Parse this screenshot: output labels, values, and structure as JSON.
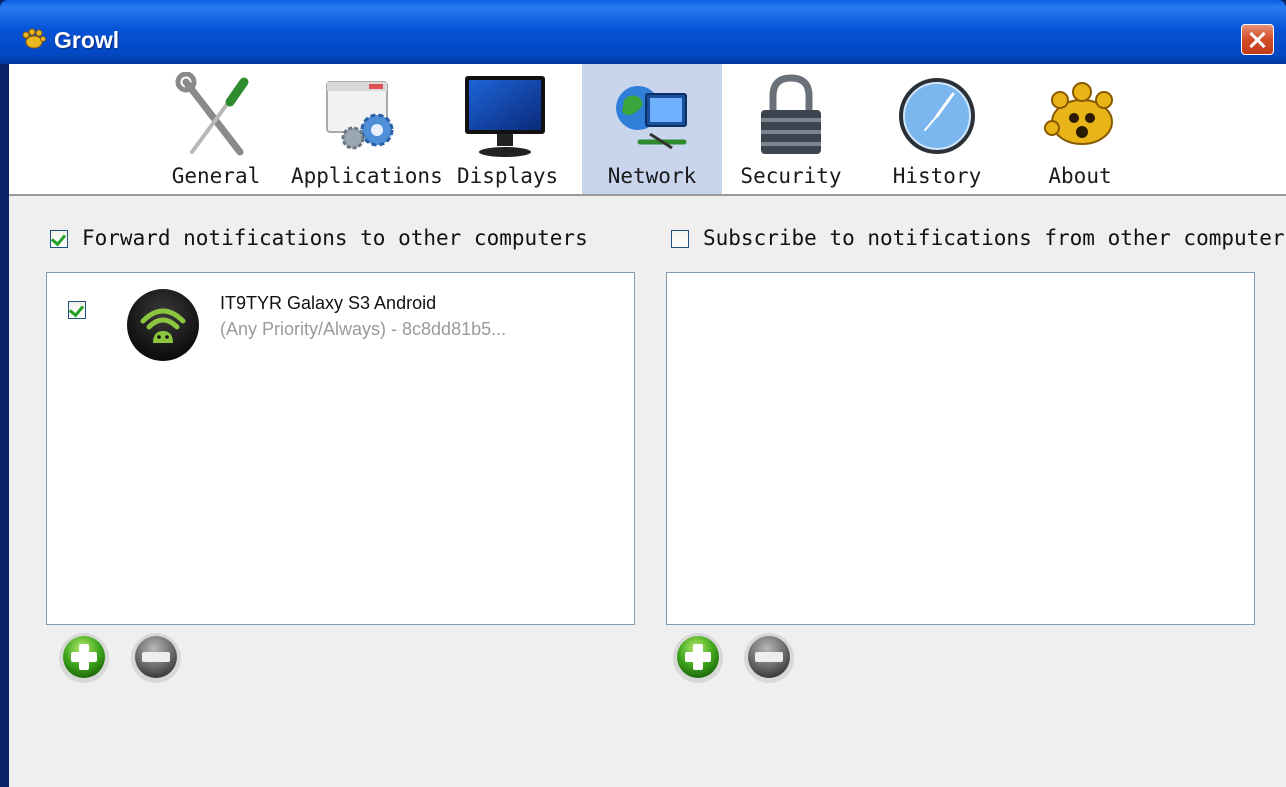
{
  "window": {
    "title": "Growl"
  },
  "toolbar": {
    "items": [
      {
        "label": "General",
        "icon": "wrench-screwdriver-icon",
        "selected": false
      },
      {
        "label": "Applications",
        "icon": "applications-gear-icon",
        "selected": false
      },
      {
        "label": "Displays",
        "icon": "monitor-icon",
        "selected": false
      },
      {
        "label": "Network",
        "icon": "network-globe-icon",
        "selected": true
      },
      {
        "label": "Security",
        "icon": "padlock-icon",
        "selected": false
      },
      {
        "label": "History",
        "icon": "clock-icon",
        "selected": false
      },
      {
        "label": "About",
        "icon": "growl-paw-icon",
        "selected": false
      }
    ]
  },
  "forward": {
    "label": "Forward notifications to other computers",
    "checked": true,
    "items": [
      {
        "checked": true,
        "name": "IT9TYR Galaxy S3 Android",
        "detail": "(Any Priority/Always) - 8c8dd81b5...",
        "icon": "android-wifi-icon"
      }
    ]
  },
  "subscribe": {
    "label": "Subscribe to notifications from other computers",
    "checked": false,
    "items": []
  },
  "colors": {
    "selected_tab": "#c8d5ec",
    "title_bar": "#0653d6",
    "check_green": "#21a121",
    "list_border": "#7f9db9"
  }
}
